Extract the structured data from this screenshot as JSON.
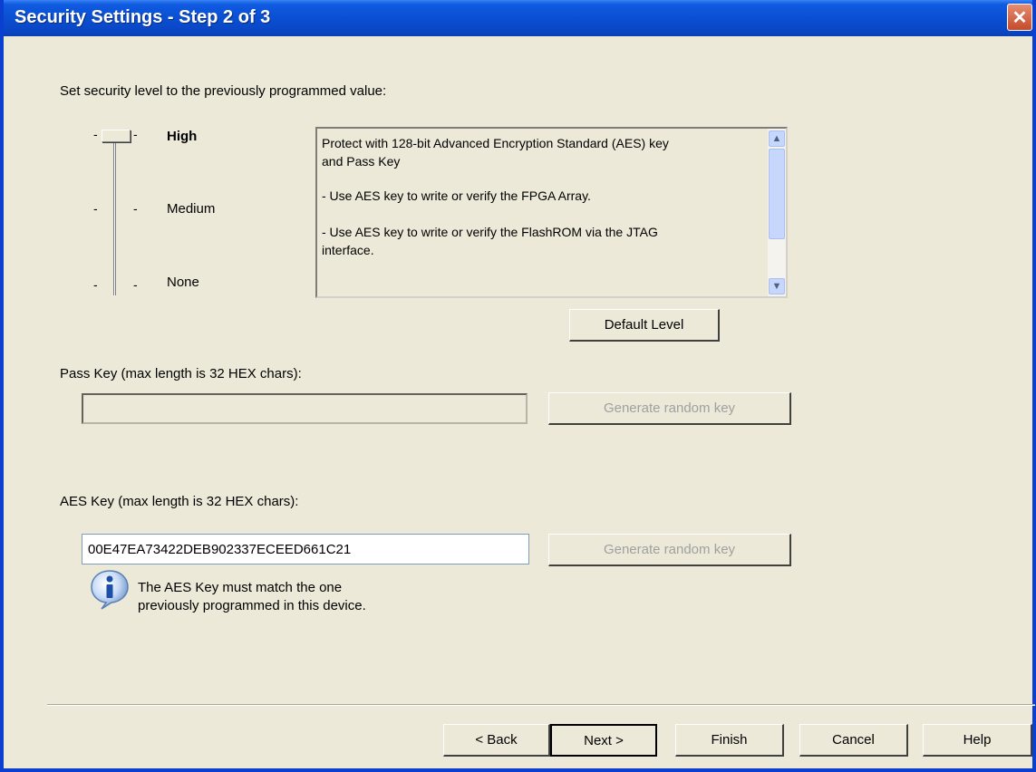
{
  "window": {
    "title": "Security Settings - Step 2 of 3",
    "close_glyph": "✕"
  },
  "intro_label": "Set security level to the previously programmed value:",
  "slider": {
    "levels": [
      "High",
      "Medium",
      "None"
    ],
    "selected": "High"
  },
  "description": {
    "lines": [
      "Protect with 128-bit Advanced Encryption Standard (AES) key",
      "and Pass Key",
      "- Use AES key to write or verify the FPGA Array.",
      "- Use AES key to write or verify the FlashROM via the JTAG",
      "interface."
    ]
  },
  "default_level_label": "Default Level",
  "pass_key": {
    "label": "Pass Key (max length is 32 HEX chars):",
    "value": "",
    "generate_label": "Generate random key"
  },
  "aes_key": {
    "label": "AES Key (max length is 32 HEX chars):",
    "value": "00E47EA73422DEB902337ECEED661C21",
    "generate_label": "Generate random key"
  },
  "info": {
    "line1": "The AES Key must match the one",
    "line2": "previously programmed in this device."
  },
  "buttons": {
    "back": "< Back",
    "next": "Next >",
    "finish": "Finish",
    "cancel": "Cancel",
    "help": "Help"
  },
  "colors": {
    "title_bar": "#0a4fd3",
    "dialog_bg": "#ece9d8"
  }
}
